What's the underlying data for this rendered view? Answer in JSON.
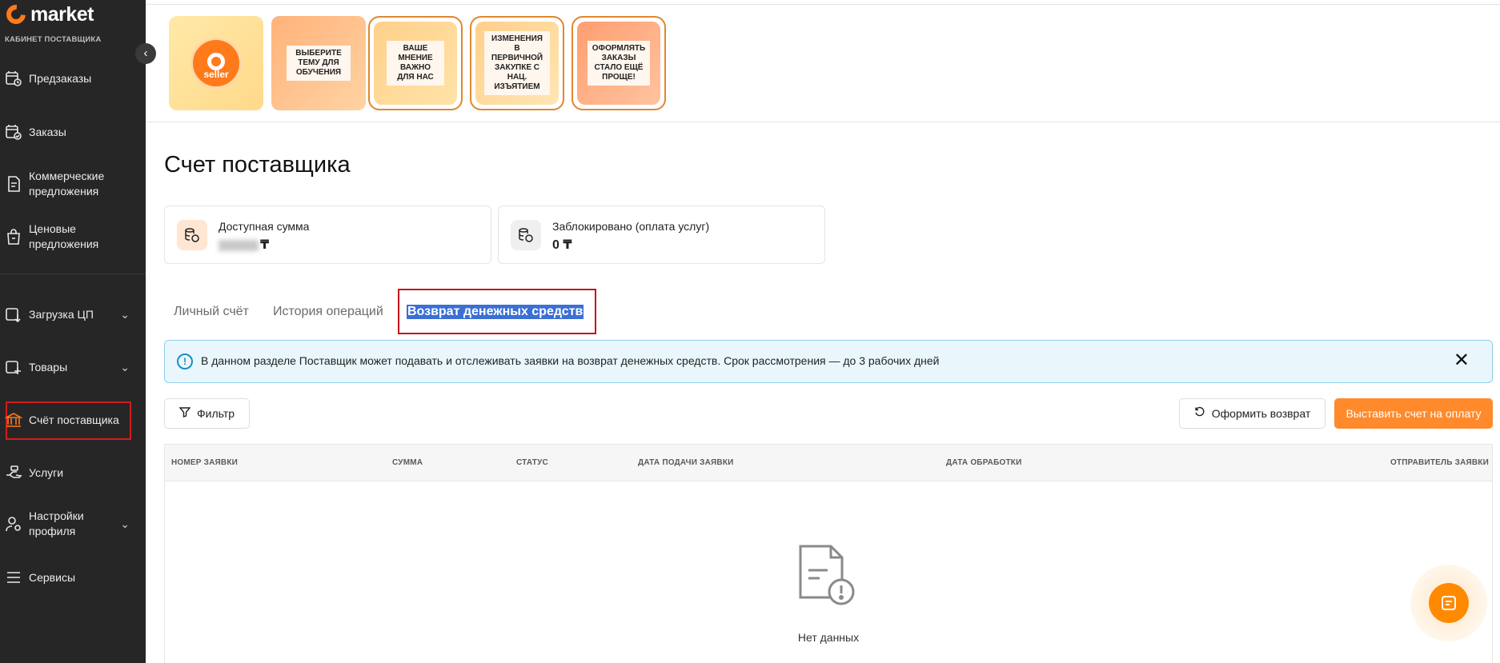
{
  "brand": {
    "name": "market",
    "subtitle": "КАБИНЕТ ПОСТАВЩИКА"
  },
  "sidebar": {
    "items": [
      {
        "label": "Предзаказы",
        "icon": "preorders-icon"
      },
      {
        "label": "Заказы",
        "icon": "orders-icon"
      },
      {
        "label": "Коммерческие предложения",
        "icon": "document-icon"
      },
      {
        "label": "Ценовые предложения",
        "icon": "price-bag-icon"
      },
      {
        "label": "Загрузка ЦП",
        "icon": "upload-icon",
        "expandable": true
      },
      {
        "label": "Товары",
        "icon": "add-product-icon",
        "expandable": true
      },
      {
        "label": "Счёт поставщика",
        "icon": "bank-icon",
        "active": true
      },
      {
        "label": "Услуги",
        "icon": "services-hand-icon"
      },
      {
        "label": "Настройки профиля",
        "icon": "profile-settings-icon",
        "expandable": true
      },
      {
        "label": "Сервисы",
        "icon": "menu-icon"
      }
    ]
  },
  "stories": [
    {
      "label": "seller",
      "type": "logo"
    },
    {
      "label": "ВЫБЕРИТЕ ТЕМУ ДЛЯ ОБУЧЕНИЯ"
    },
    {
      "label": "ВАШЕ МНЕНИЕ ВАЖНО ДЛЯ НАС"
    },
    {
      "label": "ИЗМЕНЕНИЯ В ПЕРВИЧНОЙ ЗАКУПКЕ С НАЦ. ИЗЪЯТИЕМ"
    },
    {
      "label": "ОФОРМЛЯТЬ ЗАКАЗЫ СТАЛО ЕЩЁ ПРОЩЕ!"
    }
  ],
  "page": {
    "title": "Счет поставщика"
  },
  "balances": {
    "available": {
      "label": "Доступная сумма",
      "currency": "₸"
    },
    "blocked": {
      "label": "Заблокировано (оплата услуг)",
      "value": "0 ₸"
    }
  },
  "tabs": [
    {
      "label": "Личный счёт"
    },
    {
      "label": "История операций"
    },
    {
      "label": "Возврат денежных средств",
      "active": true
    }
  ],
  "info_banner": {
    "text": "В данном разделе Поставщик может подавать и отслеживать заявки на возврат денежных средств. Срок рассмотрения — до 3 рабочих дней",
    "close": "✕"
  },
  "actions": {
    "filter": "Фильтр",
    "refund": "Оформить возврат",
    "invoice": "Выставить счет на оплату"
  },
  "table": {
    "columns": [
      "НОМЕР ЗАЯВКИ",
      "СУММА",
      "СТАТУС",
      "ДАТА ПОДАЧИ ЗАЯВКИ",
      "ДАТА ОБРАБОТКИ",
      "ОТПРАВИТЕЛЬ ЗАЯВКИ"
    ],
    "empty_text": "Нет данных"
  },
  "colors": {
    "accent": "#ff8a2b",
    "sidebar": "#262626",
    "info_bg": "#e9f7fd",
    "highlight": "#c4161c"
  }
}
